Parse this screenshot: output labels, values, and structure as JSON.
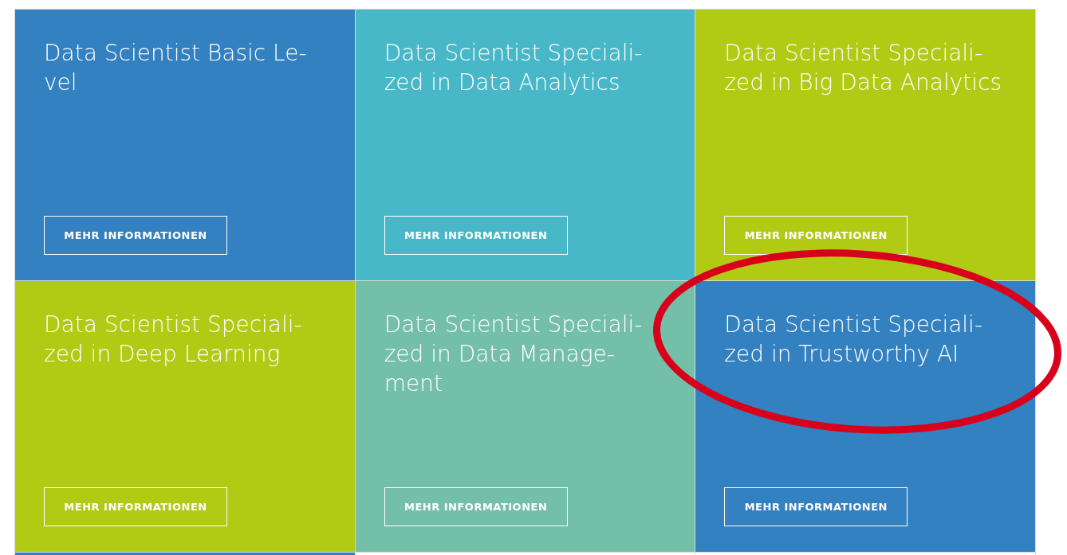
{
  "tiles": [
    {
      "title_lines": [
        "Data Scientist Basic Le-",
        "vel"
      ],
      "color": "#3381c0",
      "button": "MEHR INFORMATIONEN"
    },
    {
      "title_lines": [
        "Data Scientist Speciali-",
        "zed in Data Analytics"
      ],
      "color": "#48b8c8",
      "button": "MEHR INFORMATIONEN"
    },
    {
      "title_lines": [
        "Data Scientist Speciali-",
        "zed in Big Data Analytics"
      ],
      "color": "#b1cb14",
      "button": "MEHR INFORMATIONEN"
    },
    {
      "title_lines": [
        "Data Scientist Speciali-",
        "zed in Deep Learning"
      ],
      "color": "#b1cb14",
      "button": "MEHR INFORMATIONEN"
    },
    {
      "title_lines": [
        "Data Scientist Speciali-",
        "zed in Data Manage-",
        "ment"
      ],
      "color": "#74bfa8",
      "button": "MEHR INFORMATIONEN"
    },
    {
      "title_lines": [
        "Data Scientist Speciali-",
        "zed in Trustworthy AI"
      ],
      "color": "#3381c0",
      "button": "MEHR INFORMATIONEN",
      "highlighted": true
    }
  ]
}
